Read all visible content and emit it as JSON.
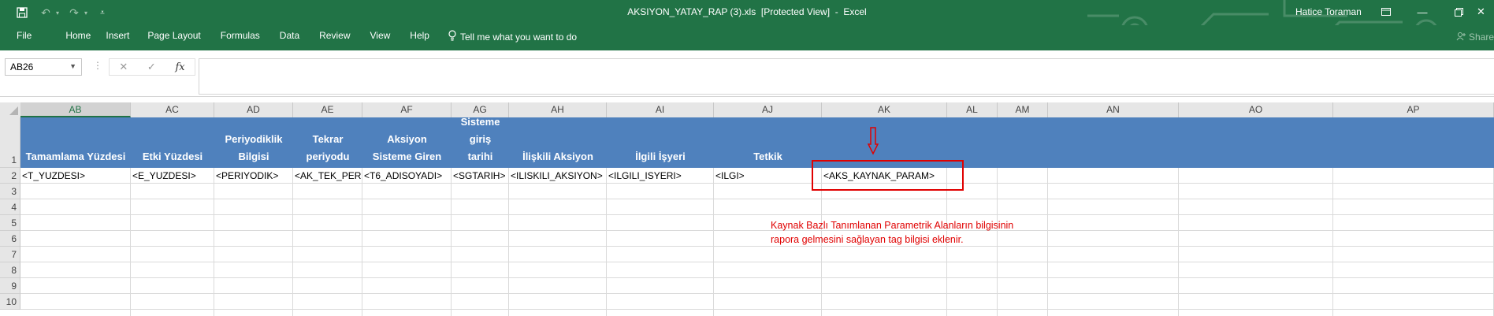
{
  "window": {
    "title": "AKSIYON_YATAY_RAP (3).xls  [Protected View]  -  Excel",
    "user": "Hatice Toraman",
    "brand_color": "#217346"
  },
  "ribbon": {
    "tabs": [
      "File",
      "Home",
      "Insert",
      "Page Layout",
      "Formulas",
      "Data",
      "Review",
      "View",
      "Help"
    ],
    "tell_me": "Tell me what you want to do",
    "share": "Share"
  },
  "formula_bar": {
    "name_box": "AB26",
    "fx": "fx",
    "value": ""
  },
  "grid": {
    "columns": [
      "AB",
      "AC",
      "AD",
      "AE",
      "AF",
      "AG",
      "AH",
      "AI",
      "AJ",
      "AK",
      "AL",
      "AM",
      "AN",
      "AO",
      "AP"
    ],
    "selected_column": "AB",
    "rows": [
      "1",
      "2",
      "3",
      "4",
      "5",
      "6",
      "7",
      "8",
      "9",
      "10"
    ],
    "header_fill": "#4f81bd",
    "header_row": [
      [
        "Tamamlama Yüzdesi"
      ],
      [
        "Etki Yüzdesi"
      ],
      [
        "Periyodiklik",
        "Bilgisi"
      ],
      [
        "Tekrar",
        "periyodu"
      ],
      [
        "Aksiyon",
        "Sisteme Giren"
      ],
      [
        "Sisteme",
        "giriş",
        "tarihi"
      ],
      [
        "İlişkili Aksiyon"
      ],
      [
        "İlgili İşyeri"
      ],
      [
        "Tetkik"
      ],
      [
        ""
      ],
      [
        ""
      ],
      [
        ""
      ],
      [
        ""
      ],
      [
        ""
      ],
      [
        ""
      ]
    ],
    "row2": [
      "<T_YUZDESI>",
      "<E_YUZDESI>",
      "<PERIYODIK>",
      "<AK_TEK_PER>",
      "<T6_ADISOYADI>",
      "<SGTARIH>",
      "<ILISKILI_AKSIYON>",
      "<ILGILI_ISYERI>",
      "<ILGI>",
      "<AKS_KAYNAK_PARAM>",
      "",
      "",
      "",
      "",
      ""
    ]
  },
  "annotation": {
    "lines": [
      "Kaynak Bazlı Tanımlanan Parametrik Alanların bilgisinin",
      "rapora gelmesini sağlayan tag bilgisi eklenir."
    ],
    "color": "#e00000"
  }
}
